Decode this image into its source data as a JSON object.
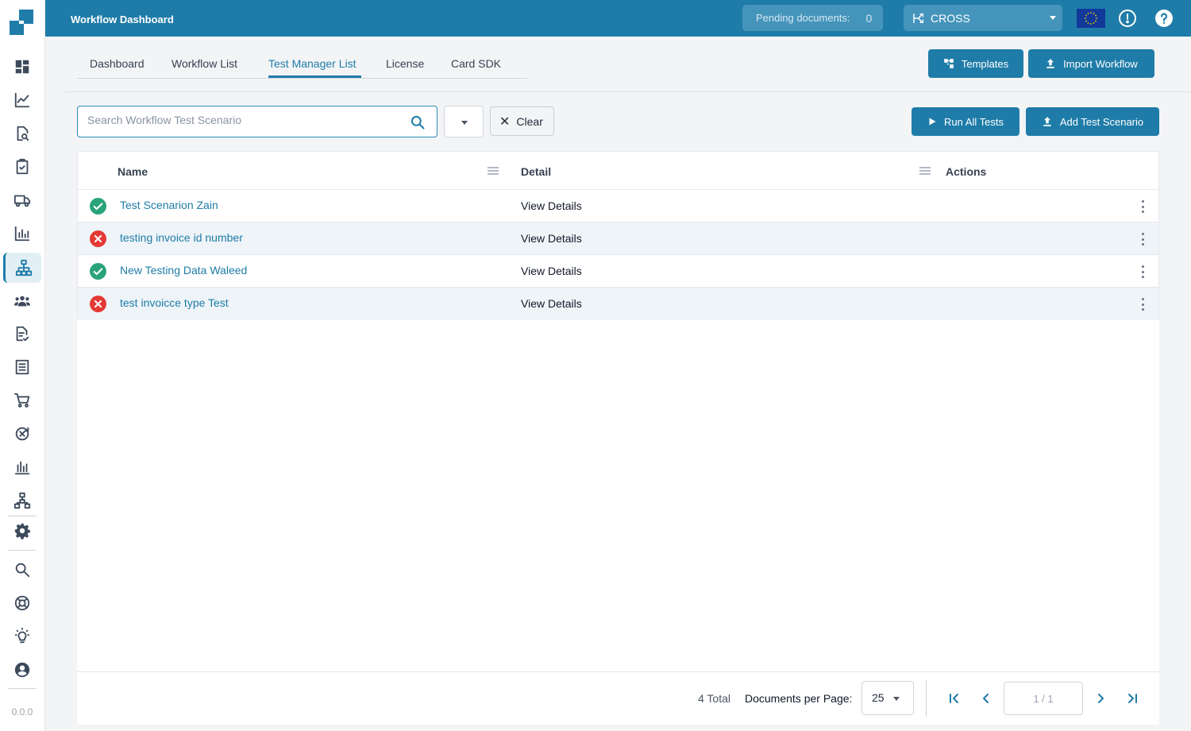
{
  "app": {
    "title": "Workflow Dashboard",
    "version": "0.0.0"
  },
  "topbar": {
    "pending_label": "Pending documents:",
    "pending_count": "0",
    "org": "CROSS",
    "flag": "eu-flag",
    "icons": [
      "alert-icon",
      "help-icon"
    ]
  },
  "sidebar": {
    "items": [
      {
        "icon": "dashboard-icon"
      },
      {
        "icon": "line-chart-icon"
      },
      {
        "icon": "document-search-icon"
      },
      {
        "icon": "clipboard-check-icon"
      },
      {
        "icon": "delivery-truck-icon"
      },
      {
        "icon": "bar-chart-icon"
      },
      {
        "icon": "workflow-hierarchy-icon",
        "active": true
      },
      {
        "icon": "users-group-icon"
      },
      {
        "icon": "document-check-icon"
      },
      {
        "icon": "list-document-icon"
      },
      {
        "icon": "shopping-cart-icon"
      },
      {
        "icon": "globe-sync-icon"
      },
      {
        "icon": "analytics-icon"
      },
      {
        "icon": "network-icon"
      },
      {
        "icon": "settings-icon"
      },
      {
        "icon": "search-icon"
      },
      {
        "icon": "support-icon"
      },
      {
        "icon": "lightbulb-icon"
      },
      {
        "icon": "account-icon"
      }
    ]
  },
  "tabs": [
    {
      "label": "Dashboard"
    },
    {
      "label": "Workflow List"
    },
    {
      "label": "Test Manager List",
      "active": true
    },
    {
      "label": "License"
    },
    {
      "label": "Card SDK"
    }
  ],
  "header_buttons": {
    "templates": "Templates",
    "import": "Import Workflow"
  },
  "search": {
    "placeholder": "Search Workflow Test Scenario",
    "value": ""
  },
  "clear_label": "Clear",
  "action_buttons": {
    "run_all": "Run All Tests",
    "add": "Add Test Scenario"
  },
  "table": {
    "columns": [
      "Name",
      "Detail",
      "Actions"
    ],
    "rows": [
      {
        "status": "passed",
        "name": "Test Scenarion Zain",
        "detail": "View Details"
      },
      {
        "status": "failed",
        "name": "testing invoice id number",
        "detail": "View Details"
      },
      {
        "status": "passed",
        "name": "New Testing Data Waleed",
        "detail": "View Details"
      },
      {
        "status": "failed",
        "name": "test invoicce type Test",
        "detail": "View Details"
      }
    ]
  },
  "footer": {
    "total": "4 Total",
    "per_page_label": "Documents per Page:",
    "per_page": "25",
    "page": "1 / 1"
  },
  "colors": {
    "primary": "#1f7ca8",
    "success": "#2aa37a",
    "error": "#e53935"
  }
}
